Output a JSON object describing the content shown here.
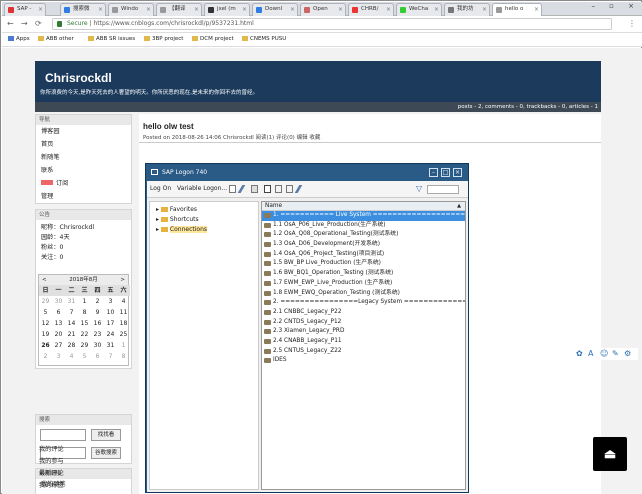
{
  "browser": {
    "tabs": [
      {
        "label": "SAP - ",
        "color": "#d33"
      },
      {
        "label": "搜索微",
        "color": "#2f7de1"
      },
      {
        "label": "Windo",
        "color": "#999"
      },
      {
        "label": "【翻译",
        "color": "#999"
      },
      {
        "label": "jxel (m",
        "color": "#333"
      },
      {
        "label": "Downl",
        "color": "#2f7de1"
      },
      {
        "label": "Open",
        "color": "#c66"
      },
      {
        "label": "CHRB/",
        "color": "#e33"
      },
      {
        "label": "WeCha",
        "color": "#3c3"
      },
      {
        "label": "我的坊",
        "color": "#777"
      },
      {
        "label": "hello o",
        "color": "#999"
      }
    ],
    "secure_label": "Secure",
    "url": "https://www.cnblogs.com/chrisrockdl/p/9537231.html",
    "bookmarks": [
      "Apps",
      "ABB other",
      "ABB SR issues",
      "3BP project",
      "DCM project",
      "CNEMS PUSU"
    ]
  },
  "blog": {
    "title": "Chrisrockdl",
    "subtitle": "你所浪费的今天,是昨天死去的人奢望的明天。你所厌恶的现在,是未来的你回不去的曾经。",
    "stats": "posts - 2, comments - 0, trackbacks - 0, articles - 1",
    "nav_header": "导航",
    "nav_items": [
      "博客园",
      "首页",
      "新随笔",
      "联系",
      "订阅",
      "管理"
    ],
    "notice_header": "公告",
    "notice_lines": [
      "昵称：Chrisrockdl",
      "园龄：4天",
      "粉丝：0",
      "关注：0"
    ],
    "calendar": {
      "month": "2018年8月",
      "weekdays": [
        "日",
        "一",
        "二",
        "三",
        "四",
        "五",
        "六"
      ],
      "days": [
        "29",
        "30",
        "31",
        "1",
        "2",
        "3",
        "4",
        "5",
        "6",
        "7",
        "8",
        "9",
        "10",
        "11",
        "12",
        "13",
        "14",
        "15",
        "16",
        "17",
        "18",
        "19",
        "20",
        "21",
        "22",
        "23",
        "24",
        "25",
        "26",
        "27",
        "28",
        "29",
        "30",
        "31",
        "1",
        "2",
        "3",
        "4",
        "5",
        "6",
        "7",
        "8"
      ]
    },
    "search_header": "搜索",
    "search_btn": "找找看",
    "google_btn": "谷歌搜索",
    "common_header": "常用链接",
    "common_links": [
      "我的随笔",
      "我的评论",
      "我的参与",
      "最新评论",
      "我的标签"
    ],
    "post_title": "hello olw test",
    "post_meta": "Posted on 2018-08-26 14:06 Chrisrockdl 阅读(1) 评论(0) 编辑 收藏"
  },
  "sap": {
    "window_title": "SAP Logon 740",
    "toolbar": [
      "Log On",
      "Variable Logon..."
    ],
    "tree": [
      "Favorites",
      "Shortcuts",
      "Connections"
    ],
    "list_header": "Name",
    "rows": [
      "1. =========== Live System ====================",
      "1.1 OsA_P06_Live_Production(生产系统)",
      "1.2 OsA_Q08_Operational_Testing(测试系统)",
      "1.3 OsA_D06_Development(开发系统)",
      "1.4 OsA_Q06_Project_Testing(项目测试)",
      "1.5 BW_BP Live_Production (生产系统)",
      "1.6 BW_BQ1_Operation_Testing (测试系统)",
      "1.7 EWM_EWP_Live_Production (生产系统)",
      "1.8 EWM_EWQ_Operation_Testing (测试系统)",
      "2. ================Legacy System ================",
      "2.1 CNBBC_Legacy_P22",
      "2.2 CNTDS_Legacy_P12",
      "2.3 Xiamen_Legacy_PRD",
      "2.4 CNABB_Legacy_P11",
      "2.5 CNTUS_Legacy_Z22",
      "IDES"
    ]
  },
  "colors": {
    "header": "#1b3a5c",
    "sap_title": "#2a5a86",
    "selection": "#3c8fe0"
  }
}
